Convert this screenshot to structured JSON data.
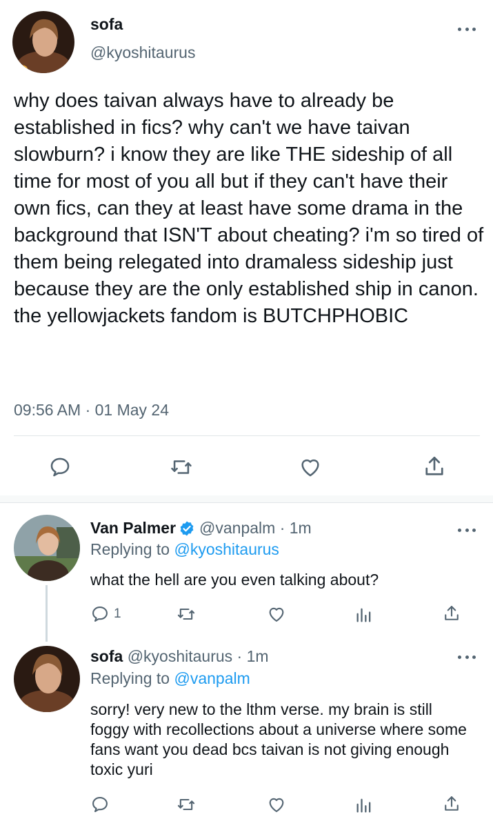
{
  "main_tweet": {
    "name": "sofa",
    "handle": "@kyoshitaurus",
    "body": "why does taivan always have to already be established in fics? why can't we have taivan slowburn? i know they are like THE sideship of all time for most of you all but if they can't have their own fics, can they at least have some drama in the background that ISN'T about cheating? i'm so tired of them being relegated into dramaless sideship just because they are the only established ship in canon. the yellowjackets fandom is BUTCHPHOBIC",
    "timestamp": "09:56 AM · 01 May 24"
  },
  "reply1": {
    "name": "Van Palmer",
    "handle_time": "@vanpalm · 1m",
    "replying_prefix": "Replying to",
    "replying_to": "@kyoshitaurus",
    "body": "what the hell are you even talking about?",
    "reply_count": "1"
  },
  "reply2": {
    "name": "sofa",
    "handle_time": "@kyoshitaurus · 1m",
    "replying_prefix": "Replying to",
    "replying_to": "@vanpalm",
    "body": "sorry! very new to the lthm verse. my brain is still foggy with recollections about a universe where some fans want you dead bcs taivan is not giving enough toxic yuri"
  },
  "colors": {
    "accent": "#1d9bf0",
    "icon": "#536471",
    "verified": "#1d9bf0"
  }
}
